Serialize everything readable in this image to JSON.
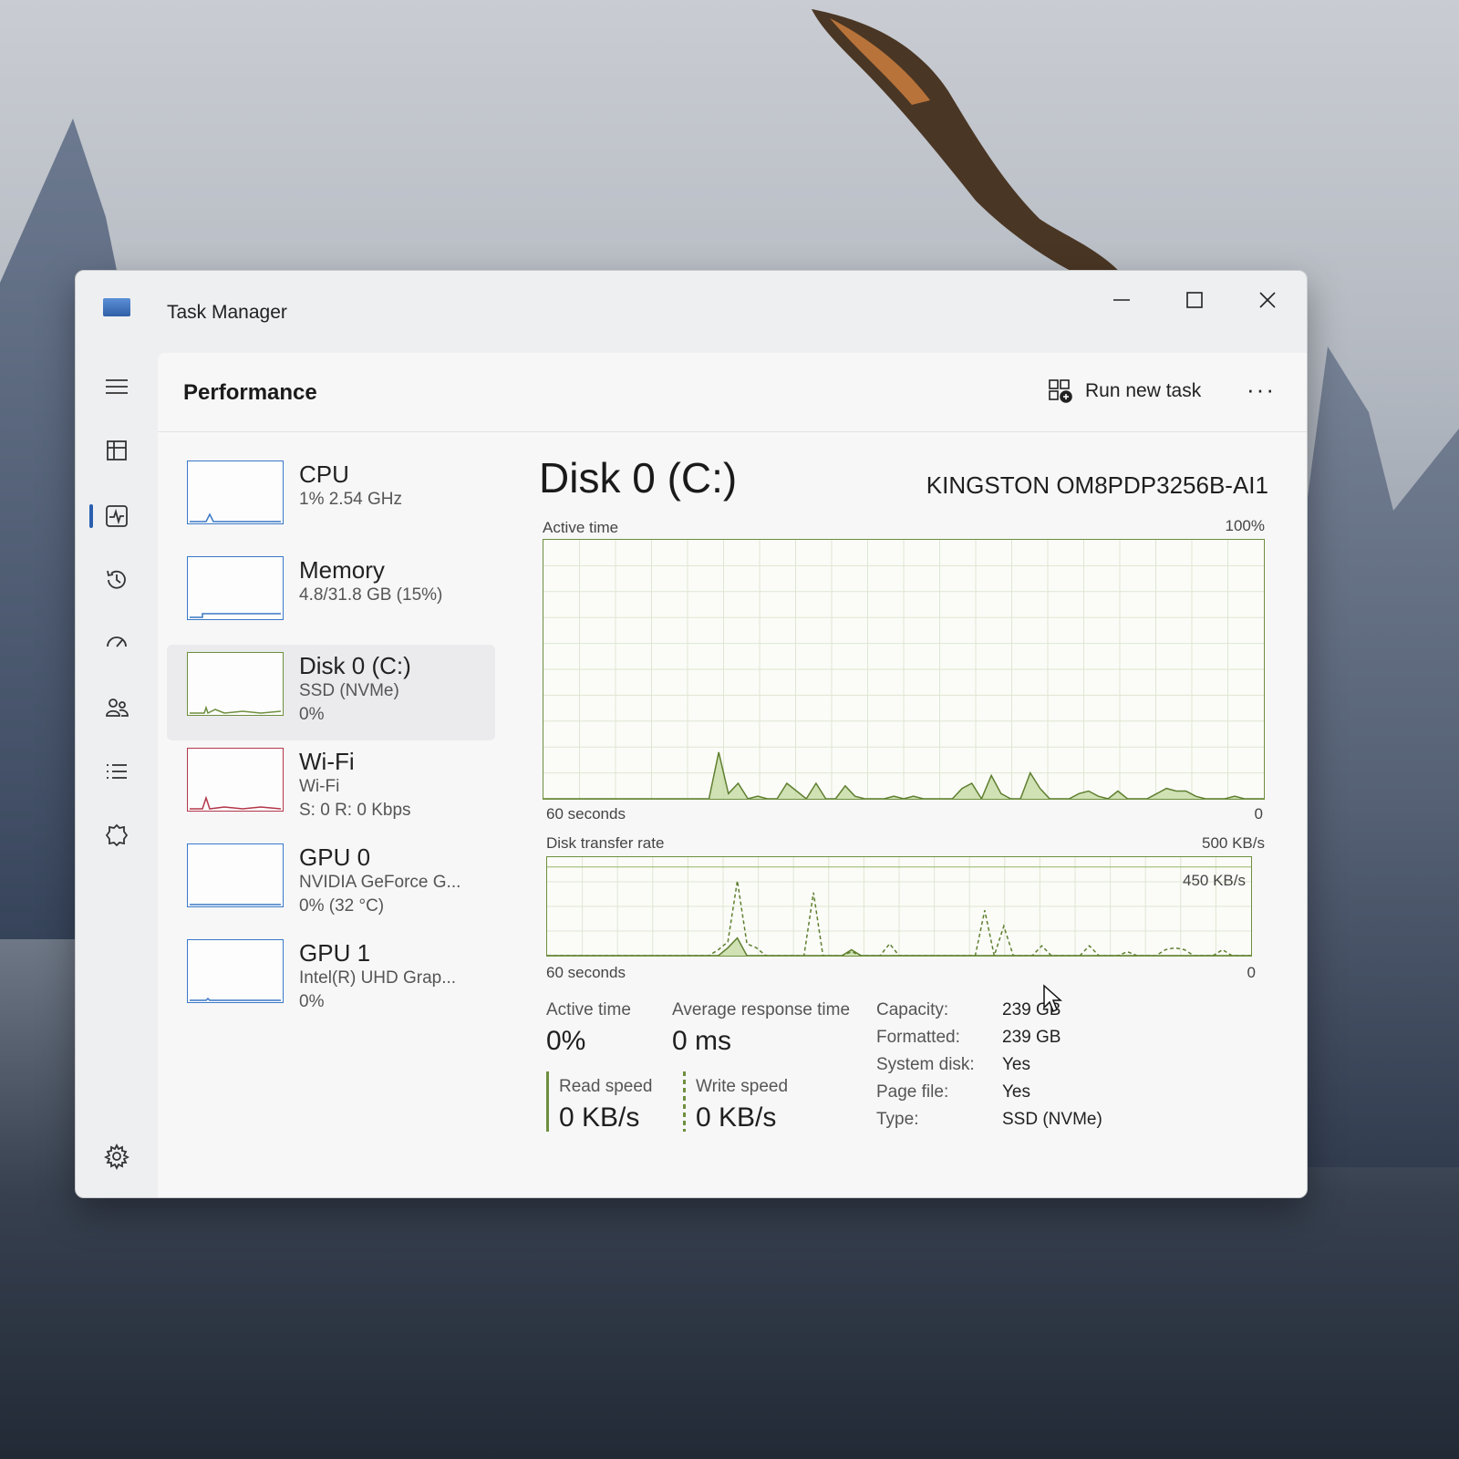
{
  "window": {
    "title": "Task Manager",
    "minimize_icon": "minimize-icon",
    "maximize_icon": "maximize-icon",
    "close_icon": "close-icon"
  },
  "nav": {
    "items": [
      {
        "name": "menu",
        "icon": "hamburger-icon"
      },
      {
        "name": "processes",
        "icon": "processes-icon"
      },
      {
        "name": "performance",
        "icon": "performance-icon",
        "selected": true
      },
      {
        "name": "app-history",
        "icon": "history-icon"
      },
      {
        "name": "startup-apps",
        "icon": "startup-icon"
      },
      {
        "name": "users",
        "icon": "users-icon"
      },
      {
        "name": "details",
        "icon": "details-icon"
      },
      {
        "name": "services",
        "icon": "services-icon"
      },
      {
        "name": "settings",
        "icon": "gear-icon"
      }
    ]
  },
  "header": {
    "title": "Performance",
    "run_task_label": "Run new task",
    "more_label": "···"
  },
  "devices": [
    {
      "name": "CPU",
      "line1": "1% 2.54 GHz",
      "line2": "",
      "color": "#3a78c7"
    },
    {
      "name": "Memory",
      "line1": "4.8/31.8 GB (15%)",
      "line2": "",
      "color": "#3a78c7"
    },
    {
      "name": "Disk 0 (C:)",
      "line1": "SSD (NVMe)",
      "line2": "0%",
      "color": "#6e8f3e",
      "selected": true
    },
    {
      "name": "Wi-Fi",
      "line1": "Wi-Fi",
      "line2": "S: 0 R: 0 Kbps",
      "color": "#b3374a"
    },
    {
      "name": "GPU 0",
      "line1": "NVIDIA GeForce G...",
      "line2": "0% (32 °C)",
      "color": "#3a78c7"
    },
    {
      "name": "GPU 1",
      "line1": "Intel(R) UHD Grap...",
      "line2": "0%",
      "color": "#3a78c7"
    }
  ],
  "detail": {
    "title": "Disk 0 (C:)",
    "model": "KINGSTON OM8PDP3256B-AI1",
    "active_graph": {
      "label": "Active time",
      "max_label": "100%",
      "time_label": "60 seconds",
      "min_label": "0",
      "values": [
        0,
        0,
        0,
        0,
        0,
        0,
        0,
        0,
        0,
        0,
        0,
        0,
        0,
        0,
        0,
        0,
        0,
        0,
        18,
        2,
        6,
        0,
        1,
        0,
        0,
        6,
        3,
        0,
        6,
        0,
        0,
        5,
        1,
        0,
        0,
        0,
        1,
        0,
        1,
        0,
        0,
        0,
        0,
        4,
        6,
        0,
        9,
        2,
        0,
        0,
        10,
        4,
        0,
        0,
        0,
        2,
        3,
        1,
        0,
        3,
        0,
        0,
        0,
        2,
        4,
        3,
        3,
        1,
        0,
        0,
        0,
        1,
        0,
        0,
        0
      ]
    },
    "transfer_graph": {
      "label": "Disk transfer rate",
      "max_label": "500 KB/s",
      "inner_label": "450 KB/s",
      "time_label": "60 seconds",
      "min_label": "0",
      "read_values": [
        0,
        0,
        0,
        0,
        0,
        0,
        0,
        0,
        0,
        0,
        0,
        0,
        0,
        0,
        0,
        0,
        0,
        0,
        0,
        40,
        90,
        0,
        0,
        0,
        0,
        0,
        0,
        0,
        0,
        0,
        0,
        0,
        30,
        0,
        0,
        0,
        0,
        0,
        0,
        0,
        0,
        0,
        0,
        0,
        0,
        0,
        0,
        0,
        0,
        0,
        0,
        0,
        0,
        0,
        0,
        0,
        0,
        0,
        0,
        0,
        0,
        0,
        0,
        0,
        0,
        0,
        0,
        0,
        0,
        0,
        0,
        0,
        0,
        0,
        0
      ],
      "write_values": [
        0,
        0,
        0,
        0,
        0,
        0,
        0,
        0,
        0,
        0,
        0,
        0,
        0,
        0,
        0,
        0,
        0,
        0,
        30,
        70,
        380,
        60,
        40,
        0,
        0,
        0,
        0,
        0,
        320,
        0,
        0,
        0,
        20,
        0,
        0,
        0,
        60,
        0,
        0,
        0,
        0,
        0,
        0,
        0,
        0,
        0,
        230,
        0,
        150,
        0,
        0,
        0,
        50,
        0,
        0,
        0,
        0,
        50,
        0,
        0,
        0,
        20,
        0,
        0,
        0,
        30,
        40,
        30,
        0,
        0,
        0,
        30,
        0,
        0,
        0
      ]
    },
    "stats": {
      "active_time_label": "Active time",
      "active_time_value": "0%",
      "response_label": "Average response time",
      "response_value": "0 ms",
      "read_label": "Read speed",
      "read_value": "0 KB/s",
      "write_label": "Write speed",
      "write_value": "0 KB/s"
    },
    "properties": [
      {
        "key": "Capacity:",
        "value": "239 GB"
      },
      {
        "key": "Formatted:",
        "value": "239 GB"
      },
      {
        "key": "System disk:",
        "value": "Yes"
      },
      {
        "key": "Page file:",
        "value": "Yes"
      },
      {
        "key": "Type:",
        "value": "SSD (NVMe)"
      }
    ]
  }
}
